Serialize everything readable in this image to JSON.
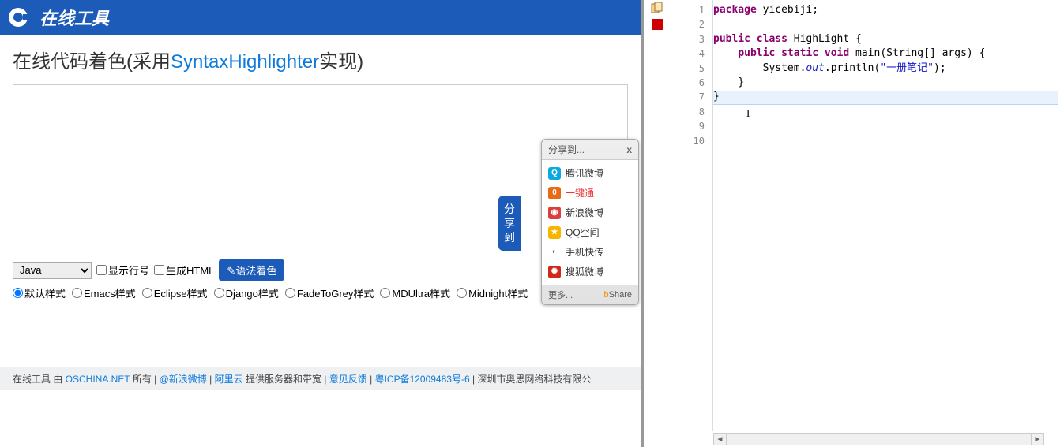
{
  "header": {
    "site_title": "在线工具"
  },
  "page": {
    "title_prefix": "在线代码着色(采用",
    "title_link": "SyntaxHighlighter",
    "title_suffix": "实现)"
  },
  "share_tab": "分享到",
  "controls": {
    "language": "Java",
    "chk_linenum": "显示行号",
    "chk_genhtml": "生成HTML",
    "btn_highlight": "语法着色"
  },
  "styles": [
    "默认样式",
    "Emacs样式",
    "Eclipse样式",
    "Django样式",
    "FadeToGrey样式",
    "MDUltra样式",
    "Midnight样式"
  ],
  "footer": {
    "t1": "在线工具 由 ",
    "oschina": "OSCHINA.NET",
    "t2": " 所有 | ",
    "weibo": "@新浪微博",
    "t3": " | ",
    "aliyun": "阿里云",
    "t4": "提供服务器和带宽 | ",
    "feedback": "意见反馈",
    "t5": " | ",
    "icp": "粤ICP备12009483号-6",
    "t6": " | 深圳市奥思网络科技有限公"
  },
  "share_popup": {
    "title": "分享到...",
    "close": "x",
    "items": [
      {
        "label": "腾讯微博",
        "bg": "#0aa9e0",
        "glyph": "Q"
      },
      {
        "label": "一键通",
        "bg": "#e86a17",
        "glyph": "0",
        "hot": true
      },
      {
        "label": "新浪微博",
        "bg": "#d94141",
        "glyph": "◉"
      },
      {
        "label": "QQ空间",
        "bg": "#f7b500",
        "glyph": "★"
      },
      {
        "label": "手机快传",
        "bg": "#fff",
        "glyph": "◐"
      },
      {
        "label": "搜狐微博",
        "bg": "#d0281a",
        "glyph": "✺"
      }
    ],
    "more": "更多...",
    "brand_b": "b",
    "brand_share": "Share"
  },
  "editor": {
    "line_count": 10,
    "code_tokens": [
      [
        {
          "t": "package ",
          "c": "kw"
        },
        {
          "t": "yicebiji;",
          "c": "id"
        }
      ],
      [],
      [
        {
          "t": "public class ",
          "c": "kw"
        },
        {
          "t": "HighLight {",
          "c": "id"
        }
      ],
      [
        {
          "t": "    ",
          "c": "id"
        },
        {
          "t": "public static void ",
          "c": "kw"
        },
        {
          "t": "main(String[] ",
          "c": "id"
        },
        {
          "t": "args",
          "c": "fn"
        },
        {
          "t": ") {",
          "c": "id"
        }
      ],
      [
        {
          "t": "        System.",
          "c": "id"
        },
        {
          "t": "out",
          "c": "st"
        },
        {
          "t": ".println(",
          "c": "id"
        },
        {
          "t": "\"一册笔记\"",
          "c": "str"
        },
        {
          "t": ");",
          "c": "id"
        }
      ],
      [
        {
          "t": "    }",
          "c": "id"
        }
      ],
      [
        {
          "t": "}",
          "c": "id"
        }
      ],
      [],
      [],
      []
    ]
  }
}
